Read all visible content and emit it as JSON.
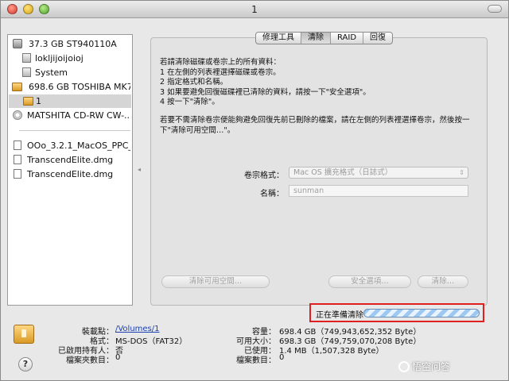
{
  "window": {
    "title": "1"
  },
  "sidebar": {
    "items": [
      {
        "label": "37.3 GB ST940110A",
        "type": "disk"
      },
      {
        "label": "lokljijoijoioj",
        "type": "volume"
      },
      {
        "label": "System",
        "type": "volume"
      },
      {
        "label": "698.6 GB TOSHIBA MK7...",
        "type": "usb-disk"
      },
      {
        "label": "1",
        "type": "usb-volume",
        "selected": true
      },
      {
        "label": "MATSHITA CD-RW CW-...",
        "type": "optical"
      },
      {
        "label": "OOo_3.2.1_MacOS_PPC_...",
        "type": "image"
      },
      {
        "label": "TranscendElite.dmg",
        "type": "image"
      },
      {
        "label": "TranscendElite.dmg",
        "type": "image"
      }
    ]
  },
  "tabs": [
    {
      "label": "修理工具"
    },
    {
      "label": "清除",
      "active": true
    },
    {
      "label": "RAID"
    },
    {
      "label": "回復"
    }
  ],
  "erase": {
    "instructions": [
      "若請清除磁碟或卷宗上的所有資料：",
      "1 在左側的列表裡選擇磁碟或卷宗。",
      "2 指定格式和名稱。",
      "3 如果要避免回復磁碟裡已清除的資料，請按一下\"安全選項\"。",
      "4 按一下\"清除\"。"
    ],
    "free_space_note": [
      "若要不需清除卷宗便能夠避免回復先前已刪除的檔案，請在左側的列表裡選擇卷宗，然後按一",
      "下\"清除可用空間…\"。"
    ],
    "format_label": "卷宗格式：",
    "format_value": "Mac OS 擴充格式（日誌式）",
    "name_label": "名稱：",
    "name_value": "sunman",
    "erase_free_space_button": "清除可用空間…",
    "security_options_button": "安全選項…",
    "erase_button": "清除…"
  },
  "progress": {
    "label": "正在準備清除",
    "indeterminate": true
  },
  "info": {
    "left": [
      {
        "label": "裝載點：",
        "value": "/Volumes/1",
        "link": true
      },
      {
        "label": "格式：",
        "value": "MS-DOS（FAT32）"
      },
      {
        "label": "已啟用持有人：",
        "value": "否"
      },
      {
        "label": "檔案夾數目：",
        "value": "0"
      }
    ],
    "right": [
      {
        "label": "容量：",
        "value": "698.4 GB（749,943,652,352 Byte）"
      },
      {
        "label": "可用大小：",
        "value": "698.3 GB（749,759,070,208 Byte）"
      },
      {
        "label": "已使用：",
        "value": "1.4 MB（1,507,328 Byte）"
      },
      {
        "label": "檔案數目：",
        "value": "0"
      }
    ]
  },
  "help_label": "?",
  "watermark": "悟空问答",
  "colors": {
    "highlight_border": "#e02020",
    "progress_stripe": "#9cc8f2",
    "link": "#1a3fb0"
  }
}
